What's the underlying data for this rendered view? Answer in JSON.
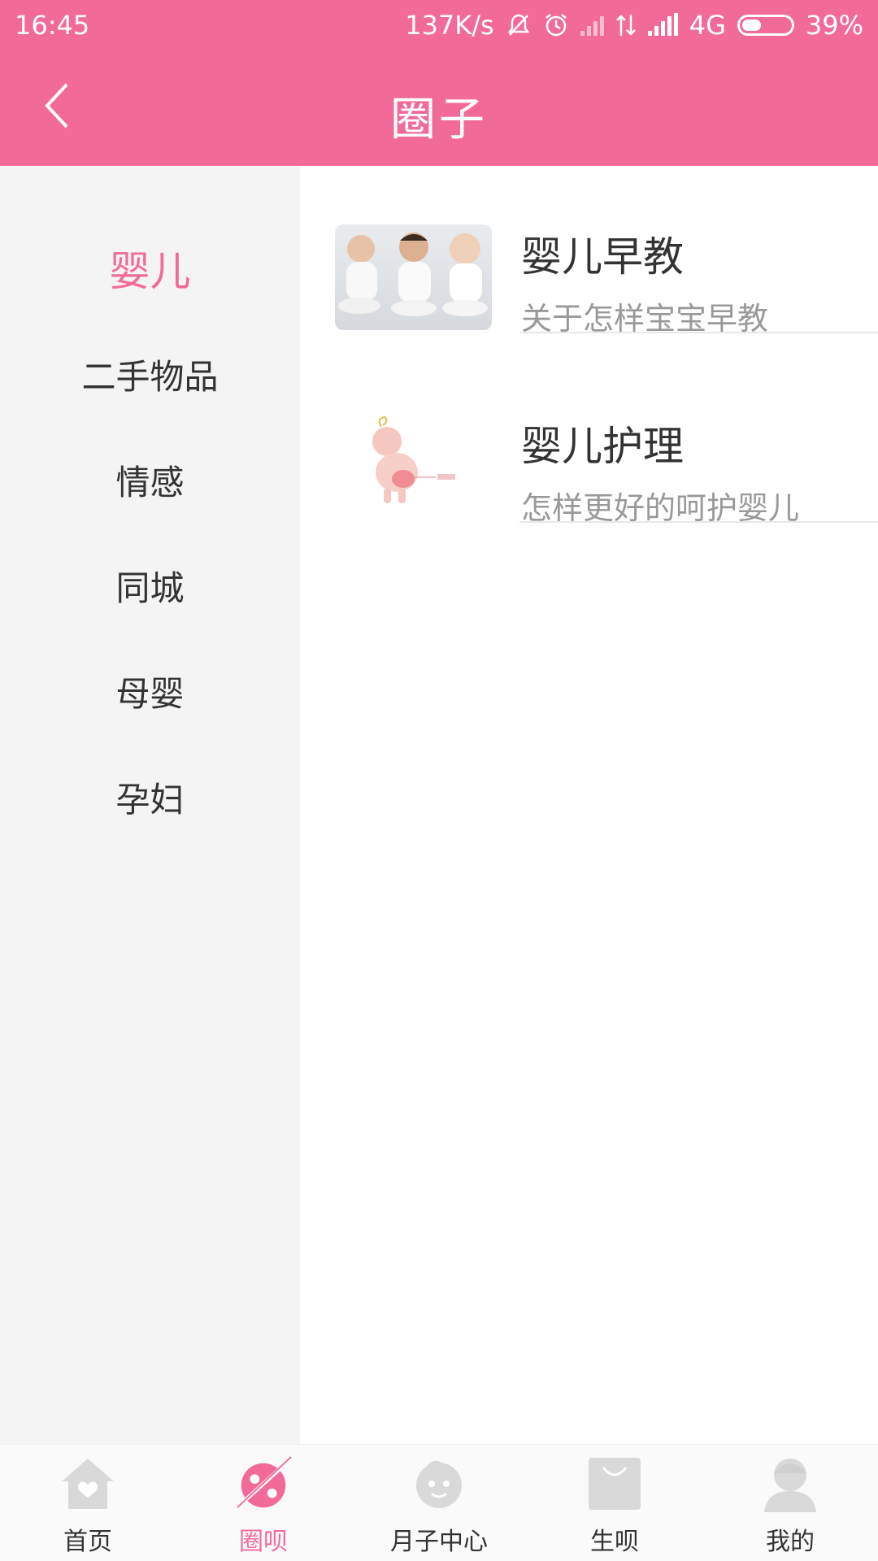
{
  "status_bar": {
    "time": "16:45",
    "net_speed": "137K/s",
    "network": "4G",
    "battery": "39%",
    "battery_level": 0.39,
    "icons": [
      "mute-bell-icon",
      "alarm-icon",
      "signal-weak-icon",
      "data-arrows-icon",
      "signal-icon",
      "battery-icon"
    ]
  },
  "nav": {
    "title": "圈子",
    "back_icon": "chevron-left-icon"
  },
  "sidebar": {
    "items": [
      {
        "label": "婴儿",
        "active": true
      },
      {
        "label": "二手物品",
        "active": false
      },
      {
        "label": "情感",
        "active": false
      },
      {
        "label": "同城",
        "active": false
      },
      {
        "label": "母婴",
        "active": false
      },
      {
        "label": "孕妇",
        "active": false
      }
    ]
  },
  "content": {
    "items": [
      {
        "title": "婴儿早教",
        "desc": "关于怎样宝宝早教",
        "thumb": "babies-photo"
      },
      {
        "title": "婴儿护理",
        "desc": "怎样更好的呵护婴儿",
        "thumb": "baby-rash-illustration"
      }
    ]
  },
  "tabbar": {
    "items": [
      {
        "label": "首页",
        "icon": "home-icon",
        "active": false
      },
      {
        "label": "圈呗",
        "icon": "planet-icon",
        "active": true
      },
      {
        "label": "月子中心",
        "icon": "baby-face-icon",
        "active": false
      },
      {
        "label": "生呗",
        "icon": "shopping-bag-icon",
        "active": false
      },
      {
        "label": "我的",
        "icon": "user-icon",
        "active": false
      }
    ]
  },
  "colors": {
    "brand": "#f26b98",
    "sidebar_bg": "#f4f4f4",
    "text_primary": "#333333",
    "text_secondary": "#999999",
    "tab_inactive_icon": "#d9d9d9"
  }
}
